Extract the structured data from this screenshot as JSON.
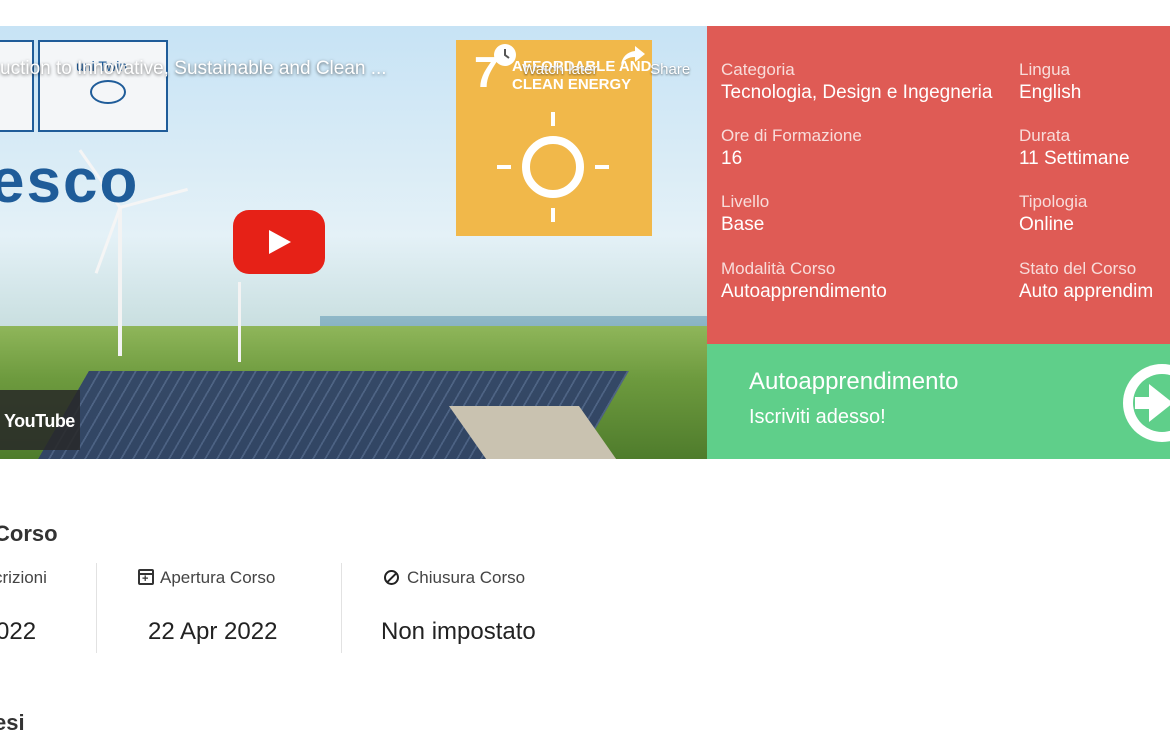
{
  "video": {
    "title": "uction to Innovative, Sustainable and Clean ...",
    "watch_later_label": "Watch later",
    "share_label": "Share",
    "logo_text": "uni Twin",
    "brand_text": "esco",
    "sdg_number": "7",
    "sdg_text_line1": "AFFORDABLE AND",
    "sdg_text_line2": "CLEAN ENERGY",
    "youtube_label": "YouTube"
  },
  "info": {
    "categoria": {
      "label": "Categoria",
      "value": "Tecnologia, Design e Ingegneria"
    },
    "lingua": {
      "label": "Lingua",
      "value": "English"
    },
    "ore": {
      "label": "Ore di Formazione",
      "value": "16"
    },
    "durata": {
      "label": "Durata",
      "value": "11 Settimane"
    },
    "livello": {
      "label": "Livello",
      "value": "Base"
    },
    "tipologia": {
      "label": "Tipologia",
      "value": "Online"
    },
    "modalita": {
      "label": "Modalità Corso",
      "value": "Autoapprendimento"
    },
    "stato": {
      "label": "Stato del Corso",
      "value": "Auto apprendim"
    }
  },
  "enroll": {
    "title": "Autoapprendimento",
    "subtitle": "Iscriviti adesso!"
  },
  "section": {
    "title": "Corso",
    "iscrizioni_label": "crizioni",
    "iscrizioni_value": "022",
    "apertura_label": "Apertura Corso",
    "apertura_value": "22 Apr 2022",
    "chiusura_label": "Chiusura Corso",
    "chiusura_value": "Non impostato"
  },
  "next_section": {
    "title": "esi"
  },
  "colors": {
    "info_bg": "#df5b55",
    "enroll_bg": "#5fcf8a",
    "play_red": "#e62117"
  }
}
